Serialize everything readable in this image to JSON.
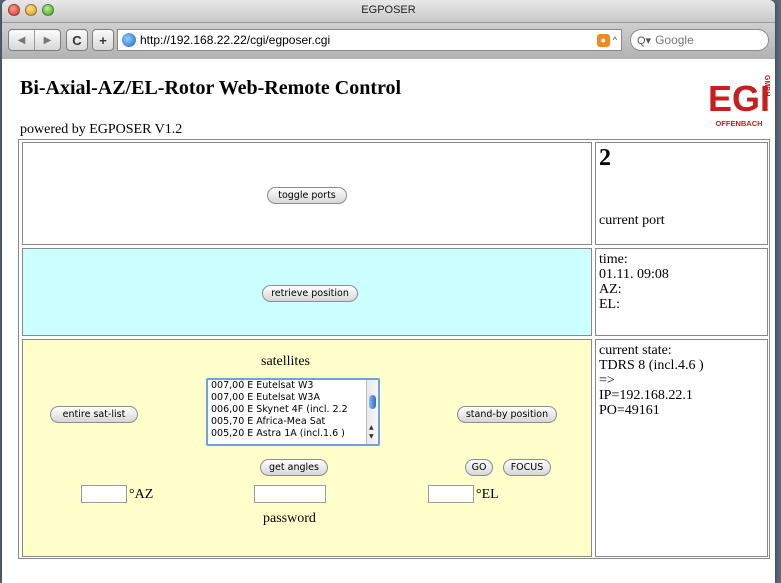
{
  "window": {
    "title": "EGPOSER"
  },
  "toolbar": {
    "back": "◀",
    "forward": "▶",
    "reload": "C",
    "add": "+",
    "url": "http://192.168.22.22/cgi/egposer.cgi",
    "search_placeholder": "Google",
    "search_prefix": "Q▾"
  },
  "page": {
    "title": "Bi-Axial-AZ/EL-Rotor Web-Remote Control",
    "powered_by": "powered by EGPOSER V1.2",
    "logo": {
      "letters": "EGIS",
      "sub": "GMBH",
      "city": "OFFENBACH",
      "color": "#c81e1e"
    }
  },
  "ports": {
    "toggle_label": "toggle ports",
    "current_value": "2",
    "current_label": "current port"
  },
  "position": {
    "retrieve_label": "retrieve position",
    "time_label": "time:",
    "time_value": "01.11. 09:08",
    "az_label": "AZ:",
    "el_label": "EL:"
  },
  "satellites": {
    "heading": "satellites",
    "entire_list_label": "entire sat-list",
    "standby_label": "stand-by position",
    "get_angles_label": "get angles",
    "go_label": "GO",
    "focus_label": "FOCUS",
    "az_unit": "°AZ",
    "el_unit": "°EL",
    "password_label": "password",
    "az_value": "",
    "el_value": "",
    "password_value": "",
    "options": [
      "007,00 E Eutelsat W3",
      "007,00 E Eutelsat W3A",
      "006,00 E Skynet 4F (incl. 2.2",
      "005,70 E Africa-Mea Sat",
      "005,20 E Astra 1A (incl.1.6 )"
    ]
  },
  "state": {
    "label": "current state:",
    "line1": "TDRS 8 (incl.4.6 )",
    "line2": "=>",
    "line3": "IP=192.168.22.1",
    "line4": "PO=49161"
  },
  "colors": {
    "row_cyan": "#ccffff",
    "row_yellow": "#ffffcc",
    "logo_red": "#c81e1e"
  }
}
